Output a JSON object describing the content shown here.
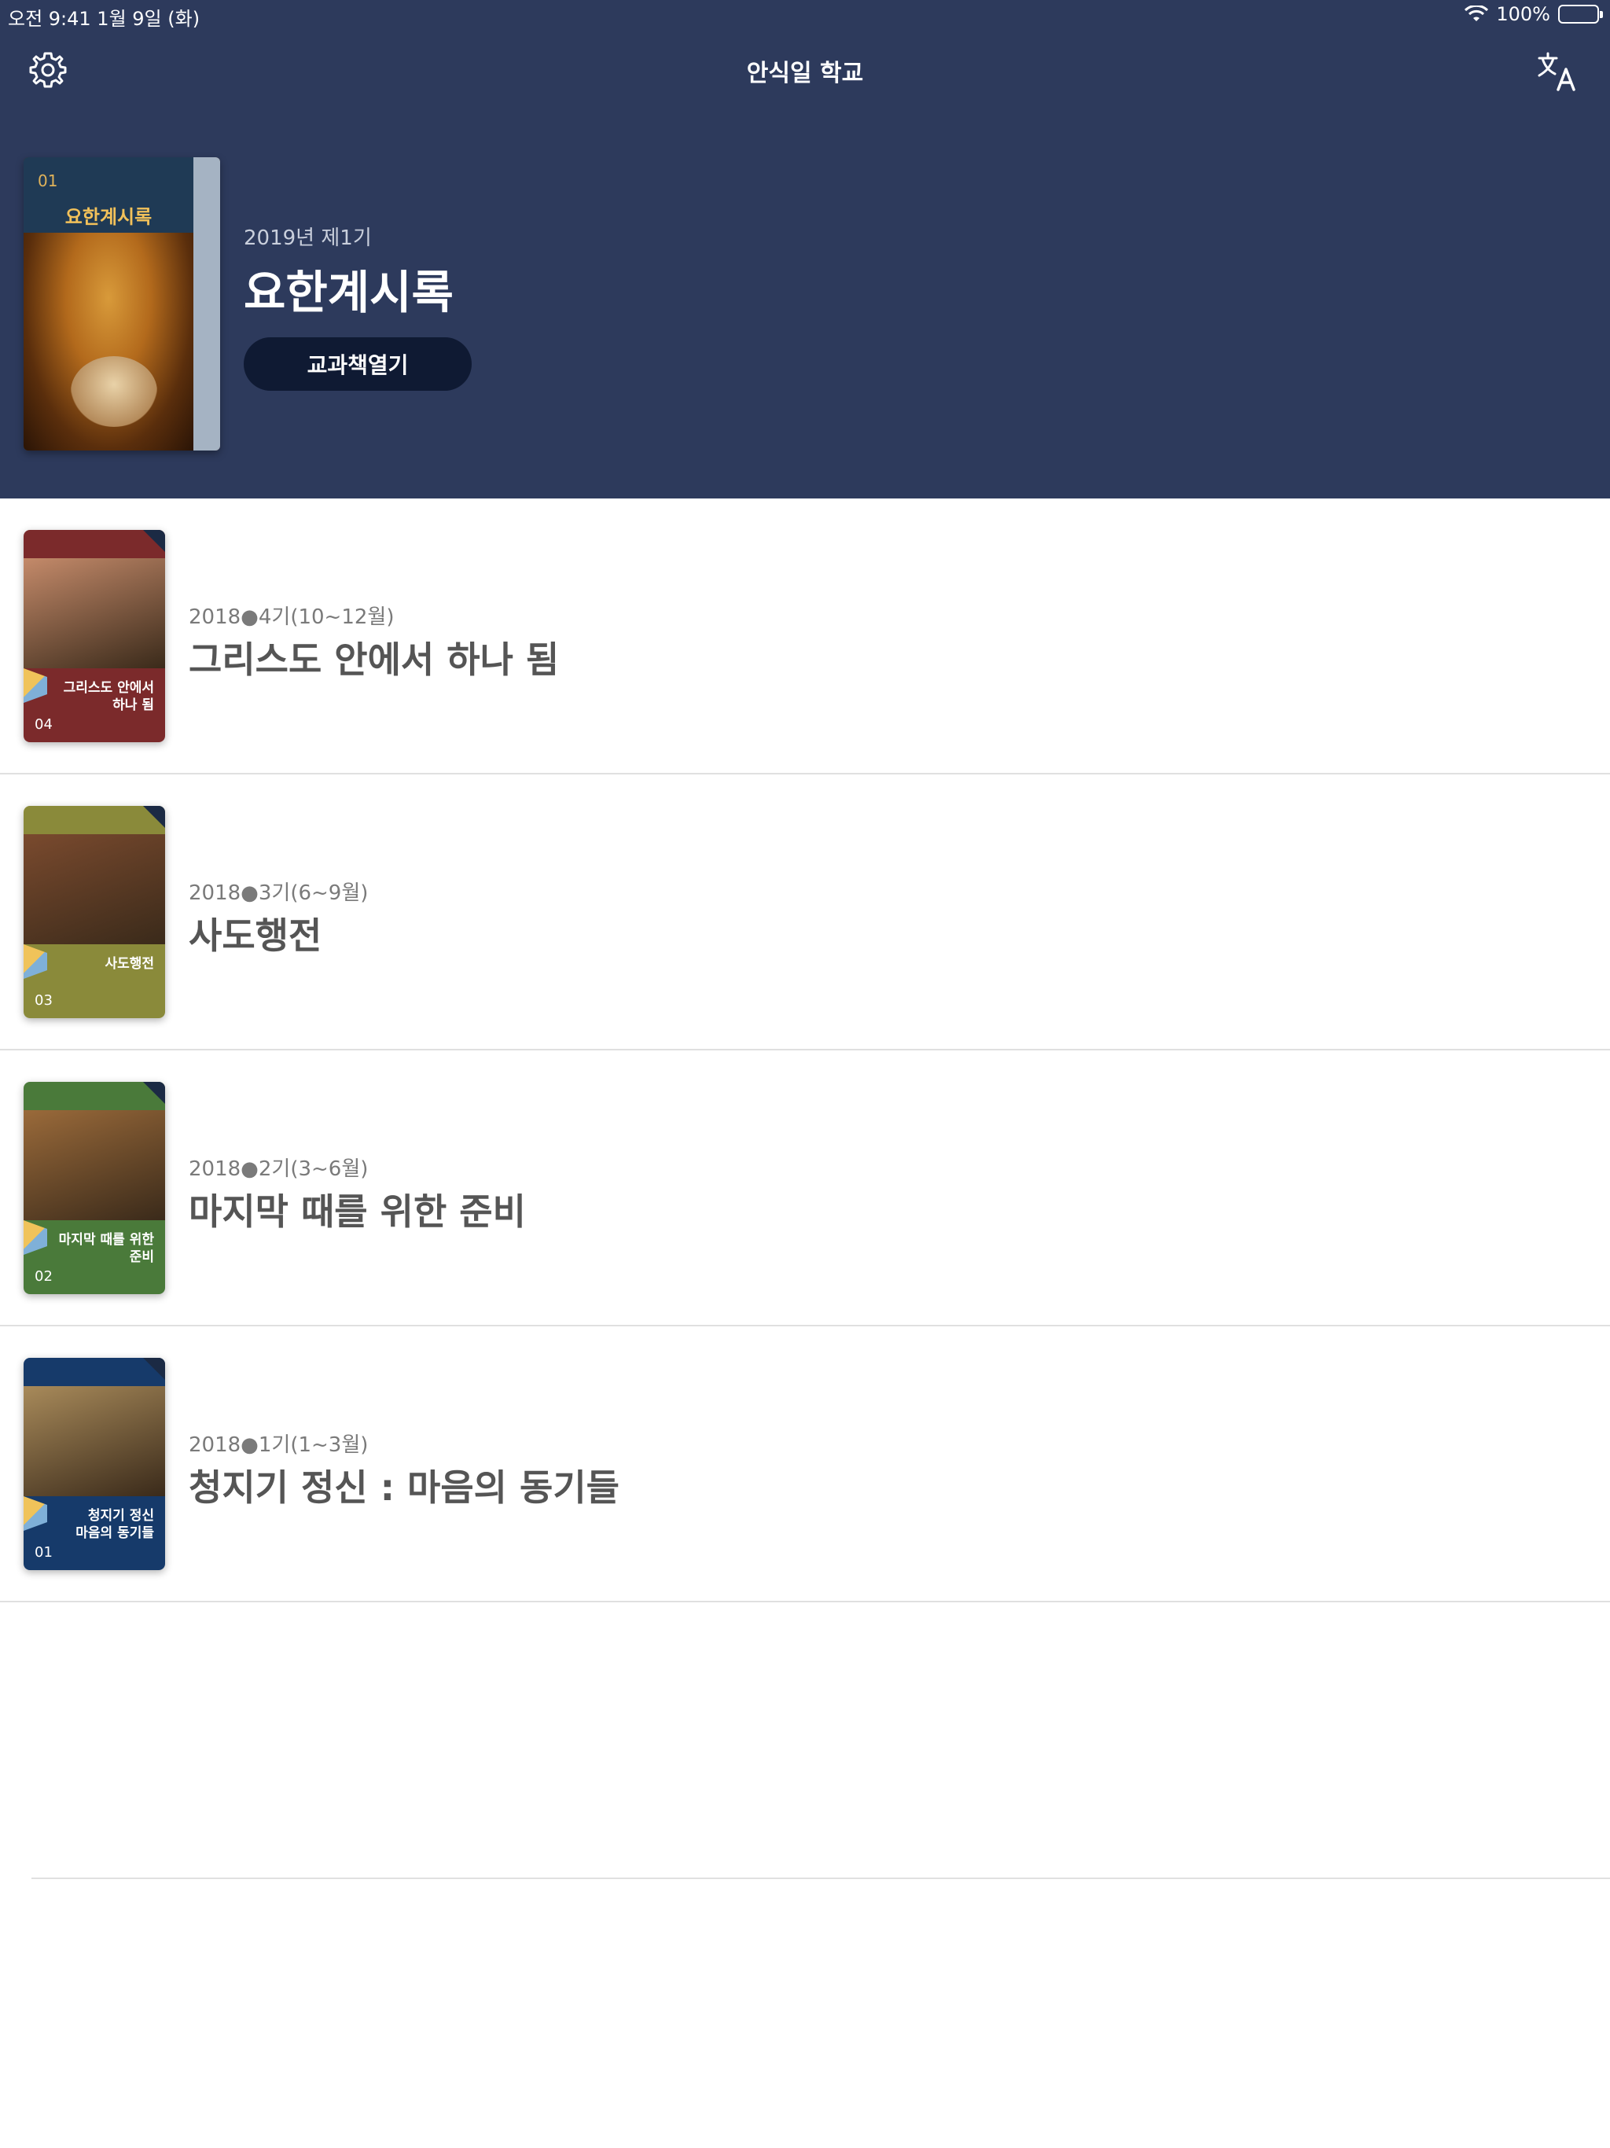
{
  "status_bar": {
    "time_date": "오전 9:41   1월 9일 (화)",
    "battery_percent": "100%",
    "battery_level": 1.0
  },
  "nav": {
    "title": "안식일 학교",
    "settings_icon": "gear-icon",
    "translate_icon": "translate-icon"
  },
  "featured": {
    "quarter": "2019년 제1기",
    "title": "요한계시록",
    "open_button": "교과책열기",
    "cover": {
      "number": "01",
      "title": "요한계시록"
    }
  },
  "lessons": [
    {
      "quarter": "2018●4기(10~12월)",
      "title": "그리스도 안에서 하나 됨",
      "cover": {
        "title_line1": "그리스도 안에서",
        "title_line2": "하나 됨",
        "number": "04",
        "band_color": "#7b2a2b",
        "photo_color": "#c48a6a"
      }
    },
    {
      "quarter": "2018●3기(6~9월)",
      "title": "사도행전",
      "cover": {
        "title_line1": "사도행전",
        "title_line2": "",
        "number": "03",
        "band_color": "#8a8a3a",
        "photo_color": "#7a4a2e"
      }
    },
    {
      "quarter": "2018●2기(3~6월)",
      "title": "마지막 때를 위한 준비",
      "cover": {
        "title_line1": "마지막 때를 위한",
        "title_line2": "준비",
        "number": "02",
        "band_color": "#4a7a3a",
        "photo_color": "#9a6a3a"
      }
    },
    {
      "quarter": "2018●1기(1~3월)",
      "title": "청지기 정신 : 마음의 동기들",
      "cover": {
        "title_line1": "청지기 정신",
        "title_line2": "마음의 동기들",
        "number": "01",
        "band_color": "#163a6a",
        "photo_color": "#a88a5a"
      }
    }
  ],
  "colors": {
    "header_bg": "#2d3a5c",
    "button_bg": "#0f1a33",
    "title_text": "#555555",
    "subtitle_text": "#7a7a7a"
  }
}
